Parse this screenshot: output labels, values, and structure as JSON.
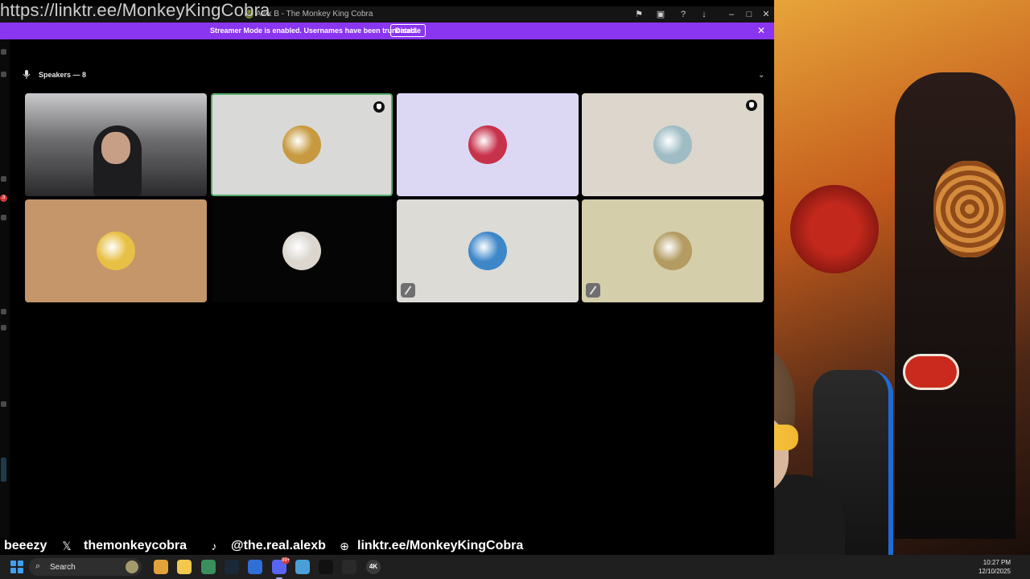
{
  "overlay": {
    "url_text": "https://linktr.ee/MonkeyKingCobra"
  },
  "window": {
    "title": "Alex B - The Monkey King Cobra",
    "title_icons": [
      "flag-icon",
      "screen-share-icon",
      "help-icon",
      "download-icon",
      "minimize-icon",
      "maximize-icon",
      "close-icon"
    ]
  },
  "banner": {
    "message": "Streamer Mode is enabled. Usernames have been truncated.",
    "disable_label": "Disable",
    "close_symbol": "✕",
    "color": "#8a35f0"
  },
  "rail": {
    "badge_count": "3"
  },
  "speakers": {
    "label": "Speakers — 8",
    "tiles": [
      {
        "kind": "video",
        "bg": "#6f6f72",
        "speaking": false,
        "shield": false,
        "muted": false
      },
      {
        "kind": "avatar",
        "bg": "#d9d9d7",
        "avatar_color": "#c79a3f",
        "speaking": true,
        "shield": true,
        "muted": false
      },
      {
        "kind": "avatar",
        "bg": "#dcd8f4",
        "avatar_color": "#c7314a",
        "speaking": false,
        "shield": false,
        "muted": false
      },
      {
        "kind": "avatar",
        "bg": "#dcd6cc",
        "avatar_color": "#9fbcc4",
        "speaking": false,
        "shield": true,
        "muted": false
      },
      {
        "kind": "avatar",
        "bg": "#c49669",
        "avatar_color": "#e8c046",
        "speaking": false,
        "shield": false,
        "muted": false
      },
      {
        "kind": "avatar",
        "bg": "#050505",
        "avatar_color": "#dcd6cf",
        "speaking": false,
        "shield": false,
        "muted": false
      },
      {
        "kind": "avatar",
        "bg": "#dcdbd6",
        "avatar_color": "#3d87c9",
        "speaking": false,
        "shield": false,
        "muted": true
      },
      {
        "kind": "avatar",
        "bg": "#d5ceaa",
        "avatar_color": "#b39b61",
        "speaking": false,
        "shield": false,
        "muted": true
      }
    ]
  },
  "socials": [
    {
      "icon": "",
      "text": "beeezy"
    },
    {
      "icon": "x-logo-icon",
      "glyph": "𝕏",
      "text": "themonkeycobra"
    },
    {
      "icon": "tiktok-icon",
      "glyph": "♪",
      "text": "@the.real.alexb"
    },
    {
      "icon": "globe-icon",
      "glyph": "⊕",
      "text": "linktr.ee/MonkeyKingCobra"
    }
  ],
  "taskbar": {
    "search_placeholder": "Search",
    "apps": [
      {
        "name": "chrome-app",
        "color": "#e2a33a"
      },
      {
        "name": "file-explorer-app",
        "color": "#f2c94c"
      },
      {
        "name": "android-app",
        "color": "#3a8f5c"
      },
      {
        "name": "steam-app",
        "color": "#1b2838"
      },
      {
        "name": "network-app",
        "color": "#2f6fd6"
      },
      {
        "name": "discord-app",
        "color": "#5865f2",
        "badge": "99+"
      },
      {
        "name": "notepad-app",
        "color": "#4aa0d6"
      },
      {
        "name": "streamdeck-app",
        "color": "#111111"
      },
      {
        "name": "obs-app",
        "color": "#2a2a2a"
      },
      {
        "name": "4k-app",
        "color": "#3a3a3a",
        "label": "4K"
      }
    ],
    "time": "10:27 PM",
    "date": "12/10/2025"
  }
}
